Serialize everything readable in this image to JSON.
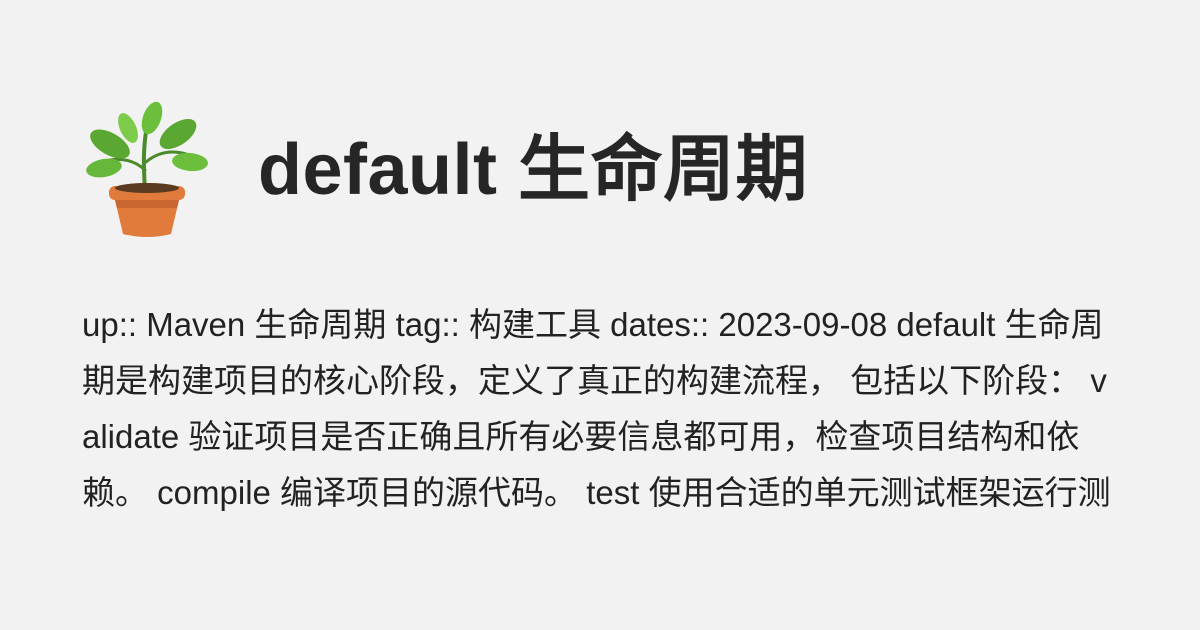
{
  "post": {
    "title": "default 生命周期",
    "excerpt": "up:: Maven 生命周期 tag:: 构建工具 dates:: 2023-09-08 default 生命周期是构建项目的核心阶段，定义了真正的构建流程， 包括以下阶段： validate 验证项目是否正确且所有必要信息都可用，检查项目结构和依赖。 compile 编译项目的源代码。 test 使用合适的单元测试框架运行测试，这些测试不要求代码被打包或部署，通常在测试阶段会编译测试代码并执行 ..."
  },
  "logo": {
    "icon": "potted-plant-icon",
    "leaf_color": "#5aa832",
    "pot_color": "#e07b3c"
  },
  "colors": {
    "background": "#f3f2f2",
    "text": "#222222"
  }
}
